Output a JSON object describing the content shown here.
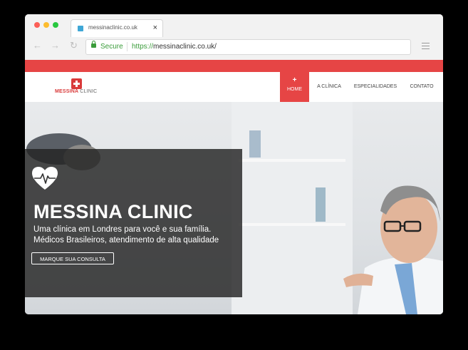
{
  "browser": {
    "tab_title": "messinaclinic.co.uk",
    "tab_close": "×",
    "back_icon": "arrow-left-icon",
    "forward_icon": "arrow-right-icon",
    "reload_icon": "reload-icon",
    "secure_label": "Secure",
    "url_scheme": "https://",
    "url_rest": "messinaclinic.co.uk/"
  },
  "site": {
    "logo_main": "MESSINA",
    "logo_sub": "CLINIC",
    "nav": {
      "active_plus": "+",
      "home": "HOME",
      "clinic": "A CLÍNICA",
      "specialties": "ESPECIALIDADES",
      "contact": "CONTATO"
    },
    "hero": {
      "title": "MESSINA CLINIC",
      "subtitle_line1": "Uma clínica em Londres para você e sua família.",
      "subtitle_line2": "Médicos Brasileiros, atendimento de alta qualidade",
      "cta": "MARQUE SUA CONSULTA"
    }
  },
  "colors": {
    "brand_red": "#e64545",
    "secure_green": "#3a9c3a"
  }
}
